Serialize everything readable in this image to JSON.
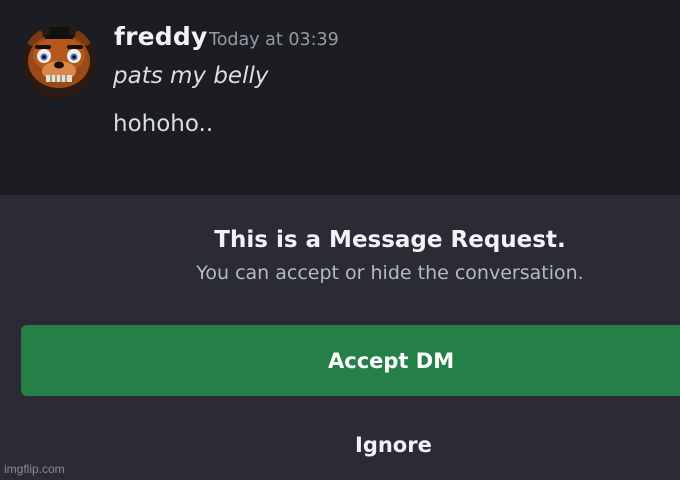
{
  "message": {
    "username": "freddy",
    "timestamp": "Today at 03:39",
    "lines": [
      "pats my belly",
      "hohoho.."
    ],
    "avatar_icon": "freddy-fazbear-avatar"
  },
  "request": {
    "title": "This is a Message Request.",
    "subtitle": "You can accept or hide the conversation.",
    "accept_label": "Accept DM",
    "ignore_label": "Ignore"
  },
  "watermark": "imgflip.com",
  "colors": {
    "background": "#1c1d22",
    "panel": "#2a2b34",
    "accept": "#248046",
    "muted": "#949ba4"
  }
}
